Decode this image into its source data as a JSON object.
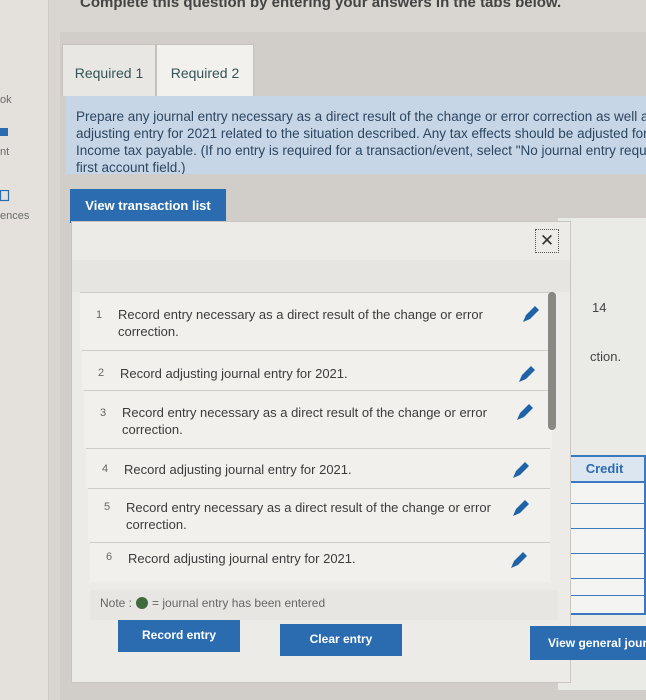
{
  "header": {
    "heading": "Complete this question by entering your answers in the tabs below."
  },
  "sidebar": {
    "items": [
      {
        "label": "ok",
        "icon": "book-icon"
      },
      {
        "label": "nt",
        "icon": "print-icon"
      },
      {
        "label": "ences",
        "icon": "references-icon"
      }
    ]
  },
  "tabs": [
    {
      "label": "Required 1",
      "active": false
    },
    {
      "label": "Required 2",
      "active": true
    }
  ],
  "instructions": "Prepare any journal entry necessary as a direct result of the change or error correction as well as any adjusting entry for 2021 related to the situation described. Any tax effects should be adjusted for through Income tax payable. (If no entry is required for a transaction/event, select \"No journal entry required\" in the first account field.)",
  "buttons": {
    "view_transactions": "View transaction list",
    "record_entry": "Record entry",
    "clear_entry": "Clear entry",
    "view_general_journal": "View general journal"
  },
  "close_symbol": "✕",
  "transactions": [
    {
      "num": "1",
      "text": "Record entry necessary as a direct result of the change or error correction."
    },
    {
      "num": "2",
      "text": "Record adjusting journal entry for 2021."
    },
    {
      "num": "3",
      "text": "Record entry necessary as a direct result of the change or error correction."
    },
    {
      "num": "4",
      "text": "Record adjusting journal entry for 2021."
    },
    {
      "num": "5",
      "text": "Record entry necessary as a direct result of the change or error correction."
    },
    {
      "num": "6",
      "text": "Record adjusting journal entry for 2021."
    }
  ],
  "note": {
    "prefix": "Note :",
    "suffix": "= journal entry has been entered"
  },
  "right_panel": {
    "number": "14",
    "fragment": "ction.",
    "credit_header": "Credit"
  },
  "colors": {
    "accent": "#2b6cb0",
    "pencil": "#1e62a8",
    "entered_dot": "#3f6a3f"
  }
}
